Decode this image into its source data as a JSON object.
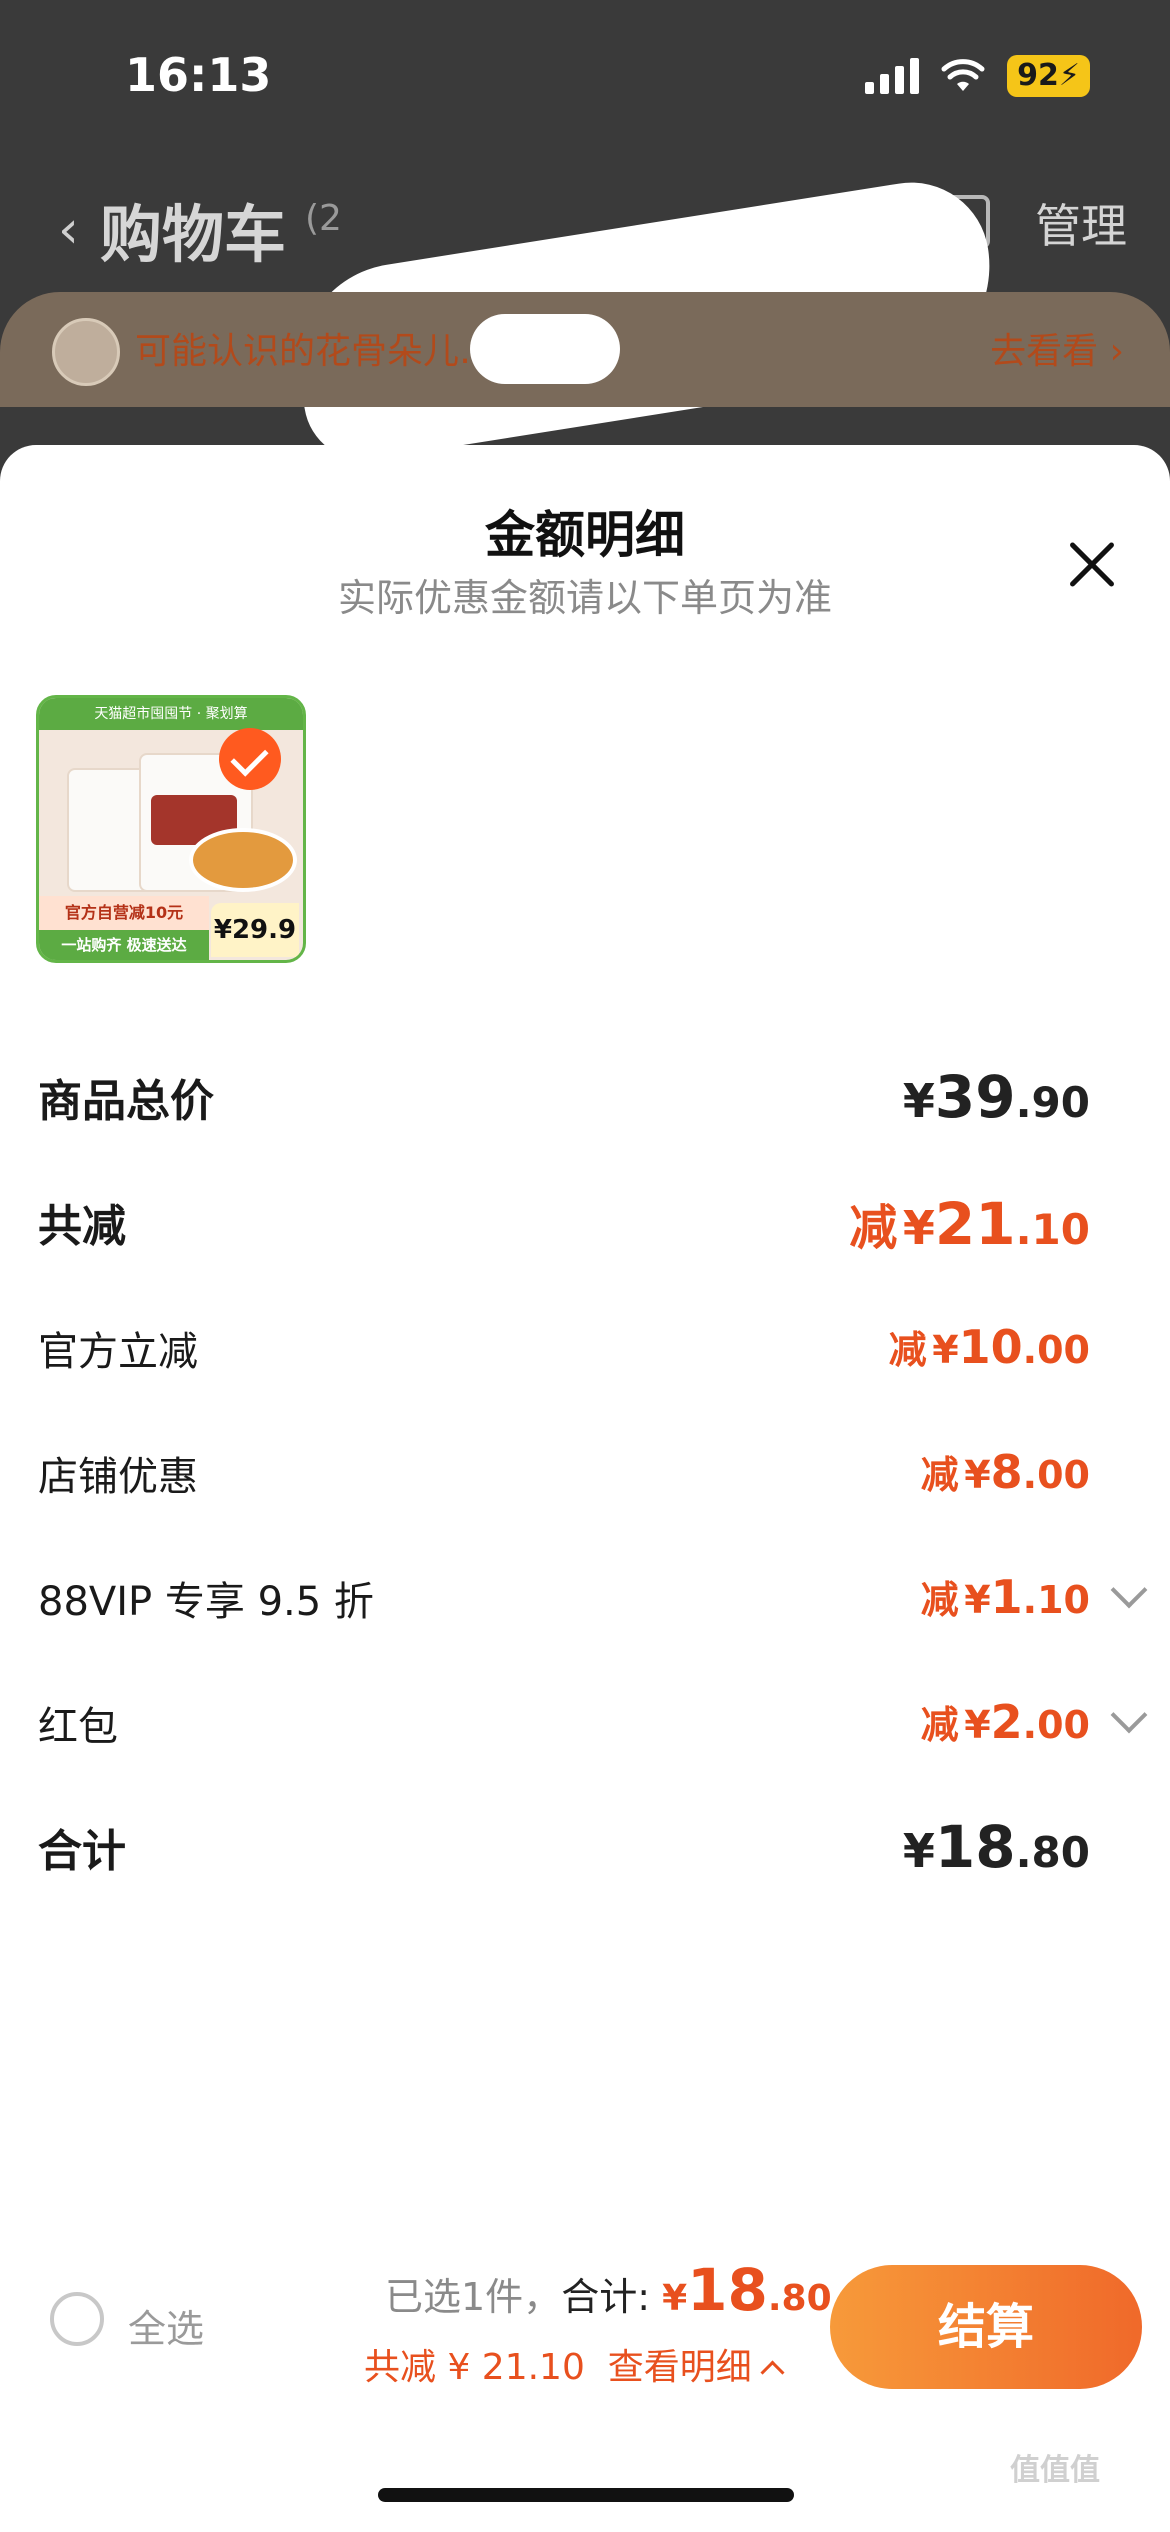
{
  "status_bar": {
    "time": "16:13",
    "battery": "92"
  },
  "cart_header": {
    "title": "购物车",
    "count": "(2",
    "manage": "管理"
  },
  "friend_banner": {
    "text": "可能认识的花骨朵儿…",
    "link": "去看看 ›"
  },
  "sheet": {
    "title": "金额明细",
    "subtitle": "实际优惠金额请以下单页为准"
  },
  "product": {
    "topbar": "天猫超市囤囤节 · 聚划算",
    "promo": "官方自营减10元",
    "strip": "一站购齐 极速送达",
    "price": "29.9",
    "selected": true
  },
  "rows": {
    "subtotal": {
      "label": "商品总价",
      "cur": "¥",
      "int": "39",
      "dec": ".90"
    },
    "total_discount": {
      "label": "共减",
      "prefix": "减",
      "cur": "¥",
      "int": "21",
      "dec": ".10"
    },
    "official": {
      "label": "官方立减",
      "prefix": "减",
      "cur": "¥",
      "int": "10",
      "dec": ".00"
    },
    "store": {
      "label": "店铺优惠",
      "prefix": "减",
      "cur": "¥",
      "int": "8",
      "dec": ".00"
    },
    "vip": {
      "label": "88VIP 专享 9.5 折",
      "prefix": "减",
      "cur": "¥",
      "int": "1",
      "dec": ".10"
    },
    "red_packet": {
      "label": "红包",
      "prefix": "减",
      "cur": "¥",
      "int": "2",
      "dec": ".00"
    },
    "total": {
      "label": "合计",
      "cur": "¥",
      "int": "18",
      "dec": ".80"
    }
  },
  "checkout": {
    "select_all": "全选",
    "selected_count": "已选1件，",
    "total_label": "合计:",
    "total_cur": "¥",
    "total_int": "18",
    "total_dec": ".80",
    "discount_text": "共减 ¥ 21.10",
    "view_detail": "查看明细",
    "button": "结算"
  },
  "watermark": "值值值",
  "colors": {
    "accent": "#e8501e",
    "button_gradient_start": "#f79a3a",
    "button_gradient_end": "#f0692a"
  }
}
